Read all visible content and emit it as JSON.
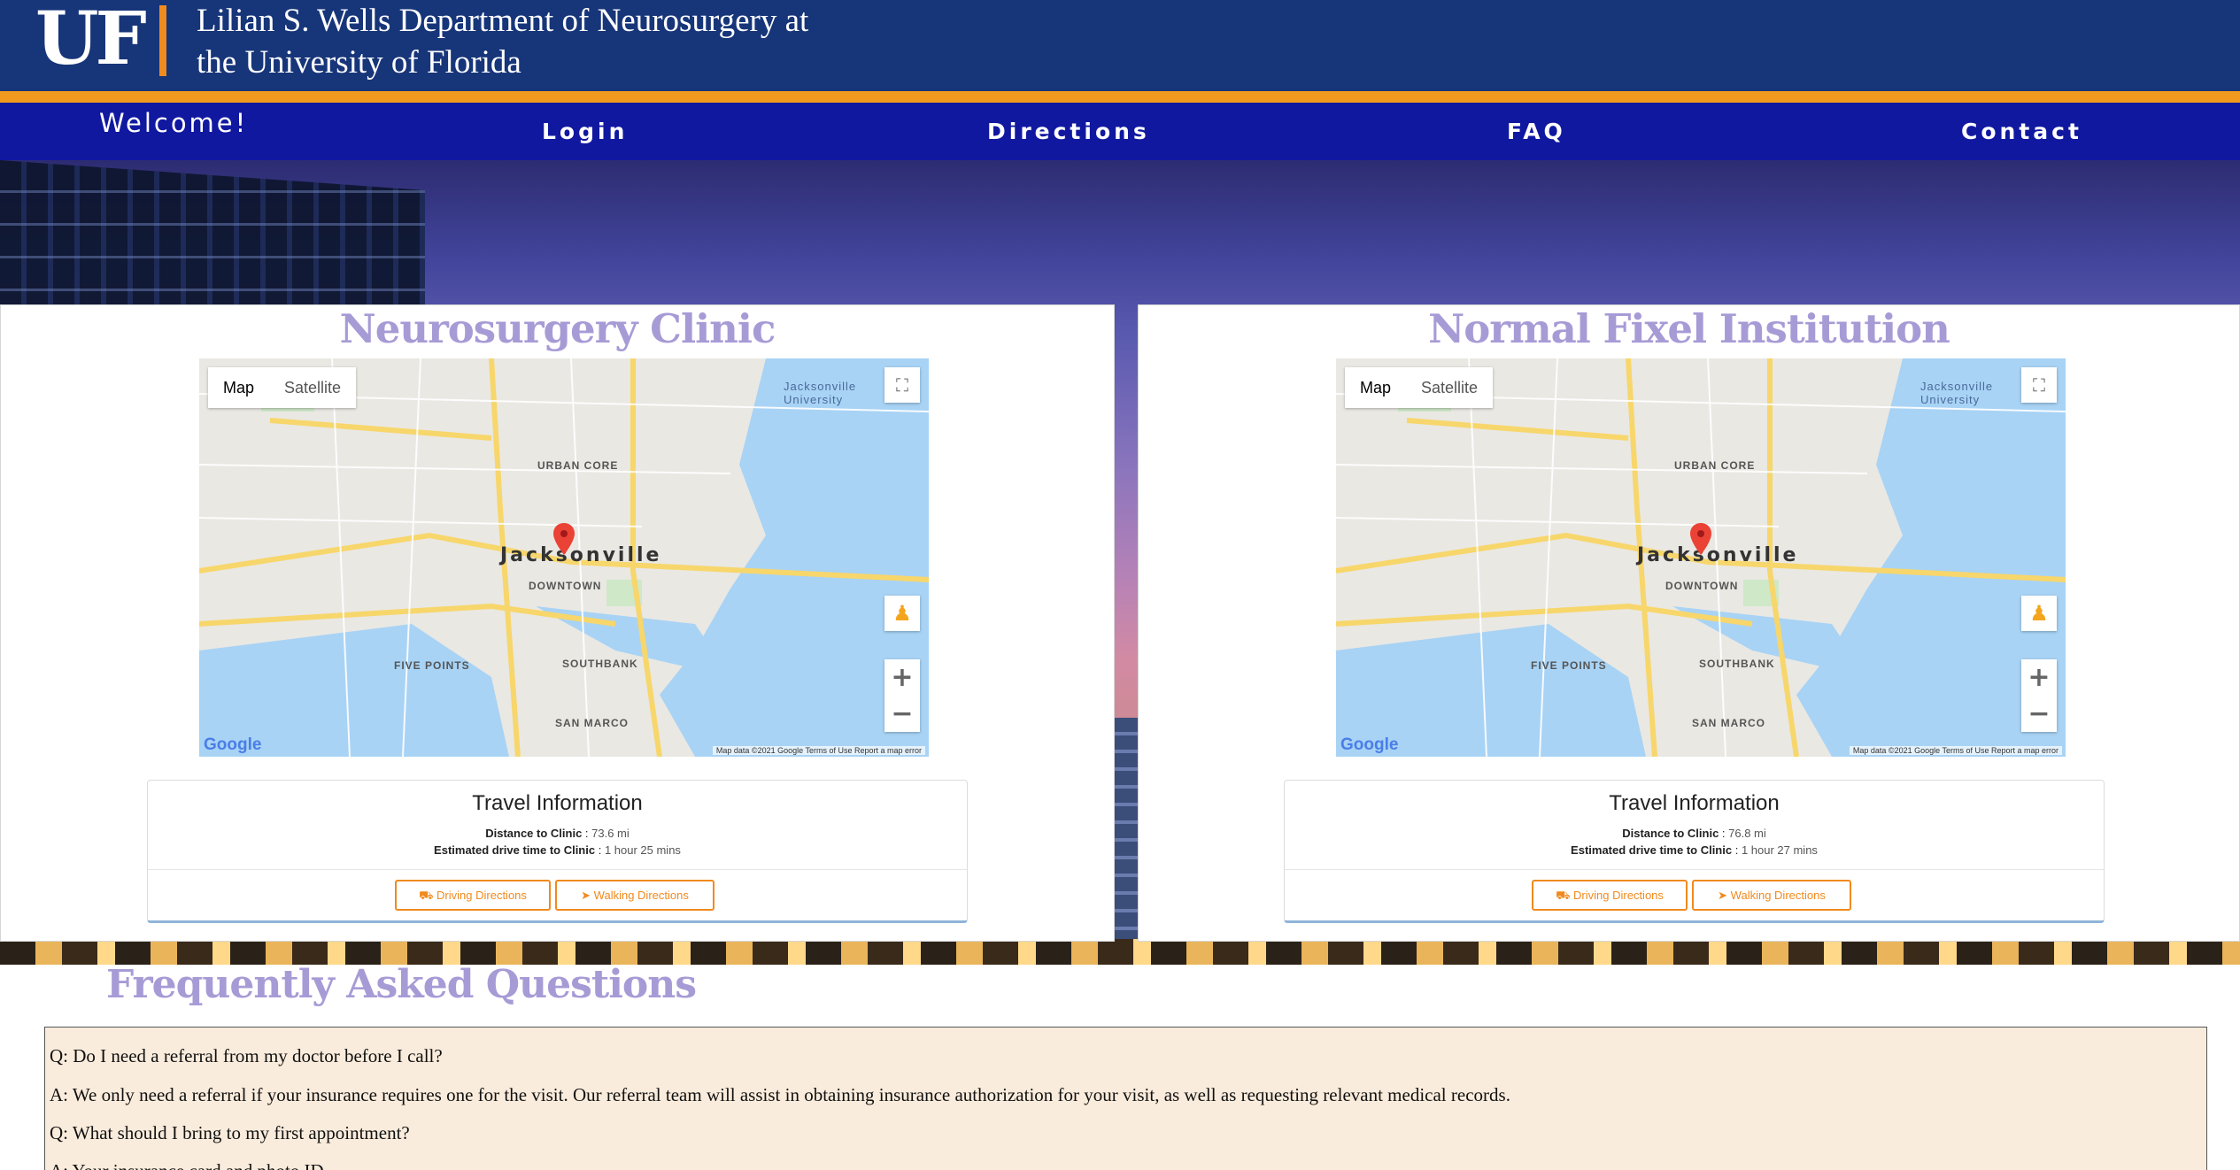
{
  "header": {
    "logo": "UF",
    "title_line1": "Lilian S. Wells Department of Neurosurgery at",
    "title_line2": "the University of Florida"
  },
  "nav": {
    "welcome": "Welcome!",
    "items": [
      "Login",
      "Directions",
      "FAQ",
      "Contact"
    ]
  },
  "clinics": [
    {
      "name": "Neurosurgery Clinic",
      "map": {
        "type_map": "Map",
        "type_satellite": "Satellite",
        "city": "Jacksonville",
        "labels": [
          "URBAN CORE",
          "DOWNTOWN",
          "FIVE POINTS",
          "SOUTHBANK",
          "SAN MARCO",
          "Jacksonville University"
        ],
        "google": "Google",
        "credits": "Map data ©2021 Google   Terms of Use   Report a map error"
      },
      "travel": {
        "title": "Travel Information",
        "distance_label": "Distance to Clinic",
        "distance_value": "73.6 mi",
        "time_label": "Estimated drive time to Clinic",
        "time_value": "1 hour 25 mins",
        "driving_label": "Driving Directions",
        "walking_label": "Walking Directions"
      }
    },
    {
      "name": "Normal Fixel Institution",
      "map": {
        "type_map": "Map",
        "type_satellite": "Satellite",
        "city": "Jacksonville",
        "labels": [
          "URBAN CORE",
          "DOWNTOWN",
          "FIVE POINTS",
          "SOUTHBANK",
          "SAN MARCO",
          "Jacksonville University"
        ],
        "google": "Google",
        "credits": "Map data ©2021 Google   Terms of Use   Report a map error"
      },
      "travel": {
        "title": "Travel Information",
        "distance_label": "Distance to Clinic",
        "distance_value": "76.8 mi",
        "time_label": "Estimated drive time to Clinic",
        "time_value": "1 hour 27 mins",
        "driving_label": "Driving Directions",
        "walking_label": "Walking Directions"
      }
    }
  ],
  "faq": {
    "title": "Frequently Asked Questions",
    "lines": [
      "Q: Do I need a referral from my doctor before I call?",
      "A: We only need a referral if your insurance requires one for the visit. Our referral team will assist in obtaining insurance authorization for your visit, as well as requesting relevant medical records.",
      "Q: What should I bring to my first appointment?",
      "A: Your insurance card and photo ID."
    ]
  },
  "colors": {
    "header_blue": "#173579",
    "accent_orange": "#f29a1d",
    "nav_blue": "#1018a0",
    "title_lavender": "#a79bd6",
    "faq_bg": "#faecdc"
  }
}
